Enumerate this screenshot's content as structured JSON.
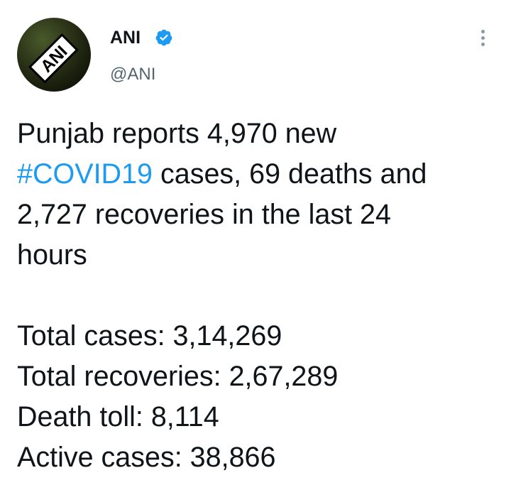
{
  "author": {
    "display_name": "ANI",
    "handle": "@ANI",
    "avatar_text": "ANI",
    "verified": true
  },
  "tweet": {
    "line1": "Punjab reports 4,970 new",
    "hashtag": "#COVID19",
    "line2_rest": " cases, 69 deaths and",
    "line3": "2,727 recoveries in the last 24",
    "line4": "hours",
    "stats": [
      "Total cases: 3,14,269",
      "Total recoveries: 2,67,289",
      "Death toll: 8,114",
      "Active cases: 38,866"
    ]
  },
  "colors": {
    "hashtag": "#1d9bf0",
    "verified_badge": "#1d9bf0",
    "handle": "#536471",
    "text": "#0f1419"
  },
  "icons": {
    "verified": "verified-badge-icon",
    "more": "more-options-icon"
  }
}
